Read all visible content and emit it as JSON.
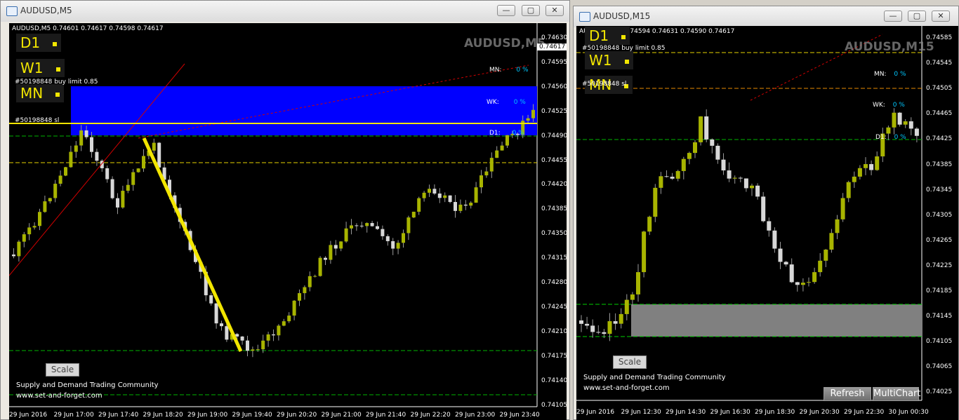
{
  "colors": {
    "bull": "#a8b400",
    "bear": "#d8d8d8",
    "zone_blue": "#0000ff",
    "zone_grey": "#808080",
    "yellow": "#f2e600",
    "cyan": "#00c8ff"
  },
  "left": {
    "window_title": "AUDUSD,M5",
    "ohlc_header": "AUDUSD,M5  0.74601 0.74617 0.74598 0.74617",
    "watermark": "AUDUSD,M5",
    "tf_labels": [
      "D1",
      "W1",
      "MN"
    ],
    "order_label_1": "#50198848 buy limit 0.85",
    "order_label_2": "#50198848 sl",
    "pct_labels": [
      {
        "label": "MN:",
        "value": "0 %"
      },
      {
        "label": "WK:",
        "value": "0 %"
      },
      {
        "label": "D1:",
        "value": "0 %"
      }
    ],
    "current_price": "0.74617",
    "price_axis": [
      "0.74630",
      "0.74595",
      "0.74560",
      "0.74525",
      "0.74490",
      "0.74455",
      "0.74420",
      "0.74385",
      "0.74350",
      "0.74315",
      "0.74280",
      "0.74245",
      "0.74210",
      "0.74175",
      "0.74140",
      "0.74105"
    ],
    "time_axis": [
      "29 Jun 2016",
      "29 Jun 17:00",
      "29 Jun 17:40",
      "29 Jun 18:20",
      "29 Jun 19:00",
      "29 Jun 19:40",
      "29 Jun 20:20",
      "29 Jun 21:00",
      "29 Jun 21:40",
      "29 Jun 22:20",
      "29 Jun 23:00",
      "29 Jun 23:40"
    ],
    "scale_button": "Scale",
    "footer_line1": "Supply and Demand Trading Community",
    "footer_line2": "www.set-and-forget.com"
  },
  "right": {
    "window_title": "AUDUSD,M15",
    "ohlc_header": "AUDUSD,M15  0.74594 0.74631 0.74590 0.74617",
    "watermark": "AUDUSD,M15",
    "tf_labels": [
      "D1",
      "W1",
      "MN"
    ],
    "order_label_1": "#50198848 buy limit 0.85",
    "order_label_2": "#50198848 sl",
    "pct_labels": [
      {
        "label": "MN:",
        "value": "0 %"
      },
      {
        "label": "WK:",
        "value": "0 %"
      },
      {
        "label": "D1:",
        "value": "0 %"
      }
    ],
    "price_axis": [
      "0.74585",
      "0.74545",
      "0.74505",
      "0.74465",
      "0.74425",
      "0.74385",
      "0.74345",
      "0.74305",
      "0.74265",
      "0.74225",
      "0.74185",
      "0.74145",
      "0.74105",
      "0.74065",
      "0.74025"
    ],
    "time_axis": [
      "29 Jun 2016",
      "29 Jun 12:30",
      "29 Jun 14:30",
      "29 Jun 16:30",
      "29 Jun 18:30",
      "29 Jun 20:30",
      "29 Jun 22:30",
      "30 Jun 00:30"
    ],
    "scale_button": "Scale",
    "refresh_button": "Refresh",
    "multichart_button": "MultiChart",
    "footer_line1": "Supply and Demand Trading Community",
    "footer_line2": "www.set-and-forget.com"
  }
}
